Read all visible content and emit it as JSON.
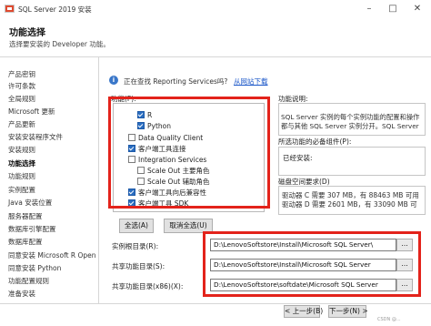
{
  "window": {
    "title": "SQL Server 2019 安装"
  },
  "header": {
    "title": "功能选择",
    "subtitle": "选择要安装的 Developer 功能。"
  },
  "sidebar": {
    "items": [
      {
        "label": "产品密钥",
        "active": false
      },
      {
        "label": "许可条款",
        "active": false
      },
      {
        "label": "全局规则",
        "active": false
      },
      {
        "label": "Microsoft 更新",
        "active": false
      },
      {
        "label": "产品更新",
        "active": false
      },
      {
        "label": "安装安装程序文件",
        "active": false
      },
      {
        "label": "安装规则",
        "active": false
      },
      {
        "label": "功能选择",
        "active": true
      },
      {
        "label": "功能规则",
        "active": false
      },
      {
        "label": "实例配置",
        "active": false
      },
      {
        "label": "Java 安装位置",
        "active": false
      },
      {
        "label": "服务器配置",
        "active": false
      },
      {
        "label": "数据库引擎配置",
        "active": false
      },
      {
        "label": "数据库配置",
        "active": false
      },
      {
        "label": "同意安装 Microsoft R Open",
        "active": false
      },
      {
        "label": "同意安装 Python",
        "active": false
      },
      {
        "label": "功能配置规则",
        "active": false
      },
      {
        "label": "准备安装",
        "active": false
      }
    ]
  },
  "info_bar": {
    "text": "正在查找 Reporting Services吗?",
    "link": "从网站下载"
  },
  "features": {
    "label": "功能(F):",
    "items": [
      {
        "label": "R",
        "checked": true,
        "indent": 2
      },
      {
        "label": "Python",
        "checked": true,
        "indent": 2
      },
      {
        "label": "Data Quality Client",
        "checked": false,
        "indent": 1
      },
      {
        "label": "客户端工具连接",
        "checked": true,
        "indent": 1
      },
      {
        "label": "Integration Services",
        "checked": false,
        "indent": 1
      },
      {
        "label": "Scale Out 主要角色",
        "checked": false,
        "indent": 2
      },
      {
        "label": "Scale Out 辅助角色",
        "checked": false,
        "indent": 2
      },
      {
        "label": "客户端工具向后兼容性",
        "checked": true,
        "indent": 1
      },
      {
        "label": "客户端工具 SDK",
        "checked": true,
        "indent": 1
      }
    ]
  },
  "buttons": {
    "select_all": "全选(A)",
    "unselect_all": "取消全选(U)"
  },
  "description": {
    "label": "功能说明:",
    "line1": "SQL Server 实例的每个实例功能的配置和操作",
    "line2": "都与其他 SQL Server 实例分开。SQL Server"
  },
  "prereq": {
    "label": "所选功能的必备组件(P):",
    "text": "已经安装:"
  },
  "disk": {
    "label": "磁盘空间要求(D)",
    "line1": "驱动器 C 需要 307 MB，有 88463 MB 可用",
    "line2": "驱动器 D 需要 2601 MB，有 33090 MB 可"
  },
  "paths": [
    {
      "label": "实例根目录(R):",
      "value": "D:\\LenovoSoftstore\\Install\\Microsoft SQL Server\\"
    },
    {
      "label": "共享功能目录(S):",
      "value": "D:\\LenovoSoftstore\\Install\\Microsoft SQL Server"
    },
    {
      "label": "共享功能目录(x86)(X):",
      "value": "D:\\LenovoSoftstore\\softdate\\Microsoft SQL Server"
    }
  ],
  "browse_label": "...",
  "footer": {
    "back": "< 上一步(B)",
    "next": "下一步(N) >",
    "watermark": "CSDN @..."
  }
}
